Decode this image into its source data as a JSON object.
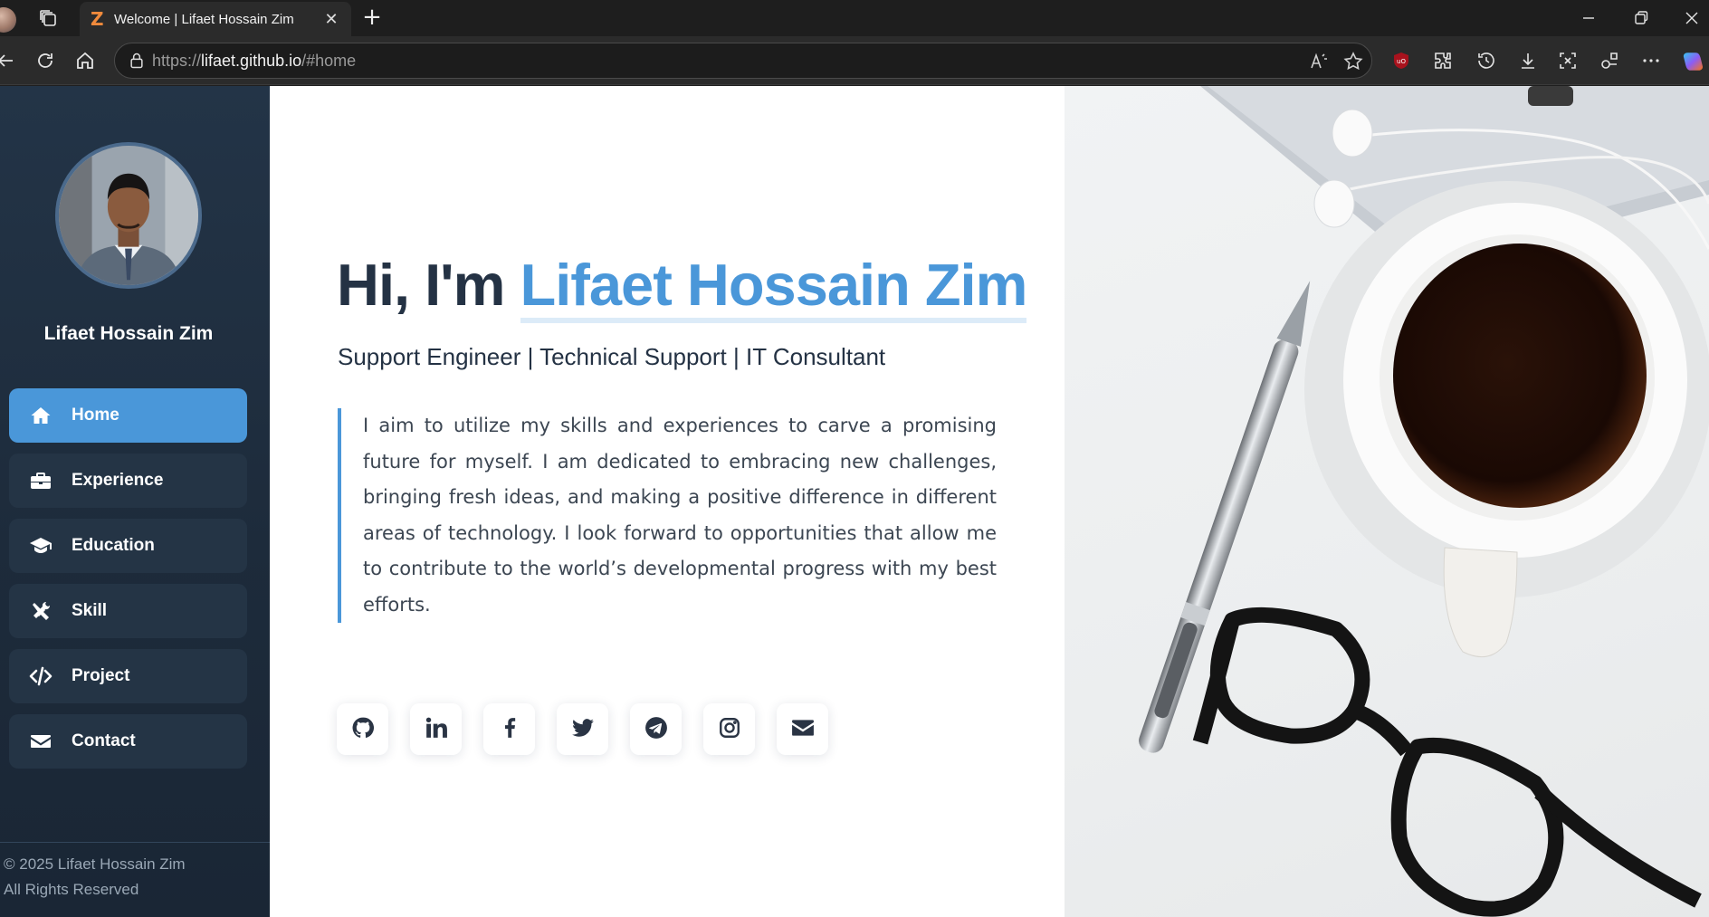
{
  "browser": {
    "tab_title": "Welcome | Lifaet Hossain Zim",
    "tab_favicon": "Z",
    "url_scheme": "https://",
    "url_domain": "lifaet.github.io",
    "url_path": "/#home",
    "icons": [
      "profile-avatar",
      "workspaces-icon",
      "back-icon",
      "refresh-icon",
      "home-icon",
      "lock-icon",
      "read-aloud-icon",
      "favorite-icon",
      "ublock-icon",
      "extensions-icon",
      "history-icon",
      "download-icon",
      "screenshot-icon",
      "collections-icon",
      "more-icon",
      "copilot-icon",
      "minimize-icon",
      "restore-icon",
      "close-icon"
    ]
  },
  "sidebar": {
    "name": "Lifaet Hossain Zim",
    "nav": [
      {
        "label": "Home",
        "icon": "home-icon",
        "active": true
      },
      {
        "label": "Experience",
        "icon": "briefcase-icon",
        "active": false
      },
      {
        "label": "Education",
        "icon": "graduation-cap-icon",
        "active": false
      },
      {
        "label": "Skill",
        "icon": "tools-icon",
        "active": false
      },
      {
        "label": "Project",
        "icon": "code-icon",
        "active": false
      },
      {
        "label": "Contact",
        "icon": "envelope-icon",
        "active": false
      }
    ],
    "footer_line1": "© 2025 Lifaet Hossain Zim",
    "footer_line2": "All Rights Reserved"
  },
  "hero": {
    "greeting_prefix": "Hi, I'm",
    "greeting_name": "Lifaet Hossain Zim",
    "role": "Support Engineer | Technical Support | IT Consultant",
    "about": "I aim to utilize my skills and experiences to carve a promising future for myself. I am dedicated to embracing new challenges, bringing fresh ideas, and making a positive difference in different areas of technology. I look forward to opportunities that allow me to contribute to the world’s developmental progress with my best efforts.",
    "socials": [
      "github-icon",
      "linkedin-icon",
      "facebook-icon",
      "twitter-icon",
      "telegram-icon",
      "instagram-icon",
      "email-icon"
    ]
  },
  "colors": {
    "accent": "#4a97d9",
    "sidebar_bg": "#1d2b3b",
    "heading": "#243244"
  }
}
